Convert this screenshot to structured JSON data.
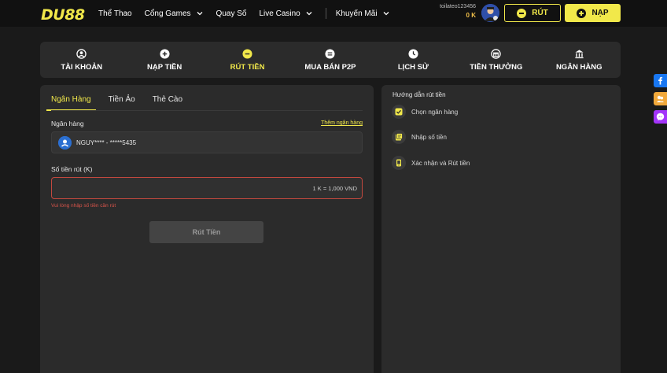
{
  "brand": {
    "logo_text": "DU88",
    "accent": "#f1e84a"
  },
  "nav": {
    "items": [
      {
        "label": "Thể Thao",
        "dropdown": false
      },
      {
        "label": "Cổng Games",
        "dropdown": true
      },
      {
        "label": "Quay Số",
        "dropdown": false
      },
      {
        "label": "Live Casino",
        "dropdown": true
      },
      {
        "label": "Khuyến Mãi",
        "dropdown": true
      }
    ]
  },
  "user": {
    "username": "toilateo123456",
    "balance": "0 K"
  },
  "actions": {
    "withdraw_label": "RÚT",
    "deposit_label": "NẠP"
  },
  "tabs": [
    {
      "label": "TÀI KHOẢN",
      "icon": "user-circle-icon"
    },
    {
      "label": "NẠP TIỀN",
      "icon": "plus-circle-icon"
    },
    {
      "label": "RÚT TIỀN",
      "icon": "minus-circle-icon",
      "active": true
    },
    {
      "label": "MUA BÁN P2P",
      "icon": "swap-circle-icon"
    },
    {
      "label": "LỊCH SỬ",
      "icon": "clock-icon"
    },
    {
      "label": "TIỀN THƯỞNG",
      "icon": "gift-icon"
    },
    {
      "label": "NGÂN HÀNG",
      "icon": "bank-icon"
    }
  ],
  "withdraw": {
    "subtabs": [
      "Ngân Hàng",
      "Tiền Ảo",
      "Thẻ Cào"
    ],
    "active_subtab": "Ngân Hàng",
    "bank_label": "Ngân hàng",
    "add_bank_link": "Thêm ngân hàng",
    "bank_account": "NGUY**** - *****5435",
    "amount_label": "Số tiền rút (K)",
    "amount_value": "",
    "rate_text": "1 K = 1,000 VND",
    "error_text": "Vui lòng nhập số tiền cần rút",
    "submit_label": "Rút Tiền"
  },
  "guide": {
    "title": "Hướng dẫn rút tiền",
    "steps": [
      "Chọn ngân hàng",
      "Nhập số tiền",
      "Xác nhận và Rút tiền"
    ]
  },
  "floating": [
    "facebook-icon",
    "chat-icon",
    "messenger-icon"
  ]
}
